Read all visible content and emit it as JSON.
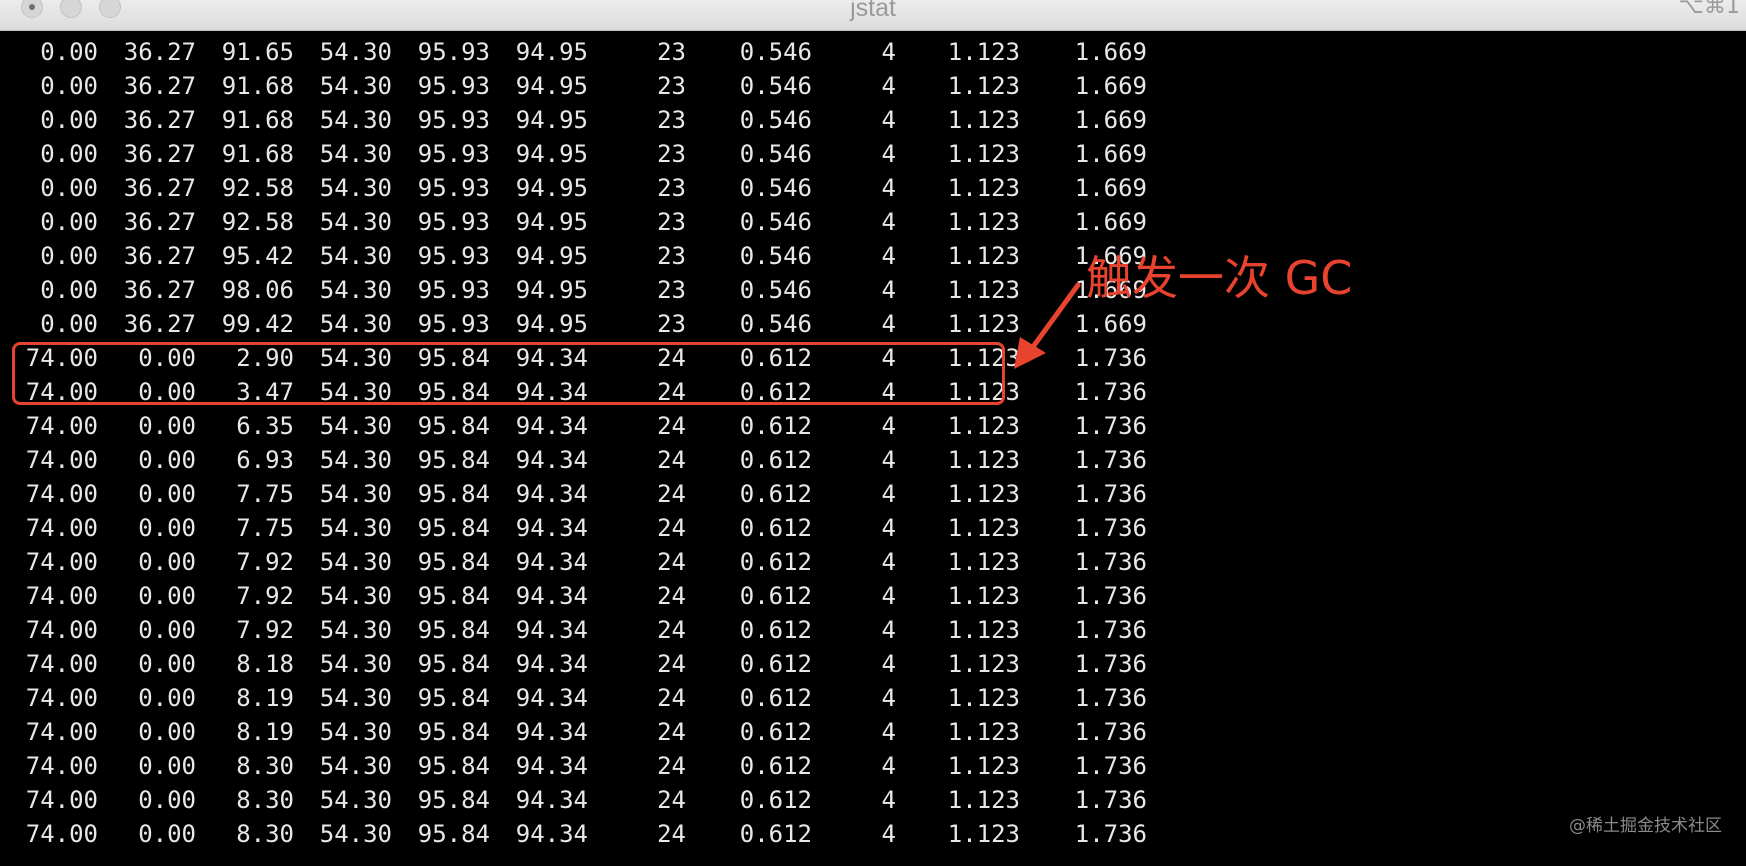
{
  "window": {
    "title": "jstat",
    "shortcut": "⌥⌘1"
  },
  "annotation": {
    "label": "触发一次 GC",
    "colors": {
      "accent": "#e8432f"
    }
  },
  "watermark": "@稀土掘金技术社区",
  "rows": [
    [
      "0.00",
      "36.27",
      "91.65",
      "54.30",
      "95.93",
      "94.95",
      "23",
      "0.546",
      "4",
      "1.123",
      "1.669"
    ],
    [
      "0.00",
      "36.27",
      "91.68",
      "54.30",
      "95.93",
      "94.95",
      "23",
      "0.546",
      "4",
      "1.123",
      "1.669"
    ],
    [
      "0.00",
      "36.27",
      "91.68",
      "54.30",
      "95.93",
      "94.95",
      "23",
      "0.546",
      "4",
      "1.123",
      "1.669"
    ],
    [
      "0.00",
      "36.27",
      "91.68",
      "54.30",
      "95.93",
      "94.95",
      "23",
      "0.546",
      "4",
      "1.123",
      "1.669"
    ],
    [
      "0.00",
      "36.27",
      "92.58",
      "54.30",
      "95.93",
      "94.95",
      "23",
      "0.546",
      "4",
      "1.123",
      "1.669"
    ],
    [
      "0.00",
      "36.27",
      "92.58",
      "54.30",
      "95.93",
      "94.95",
      "23",
      "0.546",
      "4",
      "1.123",
      "1.669"
    ],
    [
      "0.00",
      "36.27",
      "95.42",
      "54.30",
      "95.93",
      "94.95",
      "23",
      "0.546",
      "4",
      "1.123",
      "1.669"
    ],
    [
      "0.00",
      "36.27",
      "98.06",
      "54.30",
      "95.93",
      "94.95",
      "23",
      "0.546",
      "4",
      "1.123",
      "1.669"
    ],
    [
      "0.00",
      "36.27",
      "99.42",
      "54.30",
      "95.93",
      "94.95",
      "23",
      "0.546",
      "4",
      "1.123",
      "1.669"
    ],
    [
      "74.00",
      "0.00",
      "2.90",
      "54.30",
      "95.84",
      "94.34",
      "24",
      "0.612",
      "4",
      "1.123",
      "1.736"
    ],
    [
      "74.00",
      "0.00",
      "3.47",
      "54.30",
      "95.84",
      "94.34",
      "24",
      "0.612",
      "4",
      "1.123",
      "1.736"
    ],
    [
      "74.00",
      "0.00",
      "6.35",
      "54.30",
      "95.84",
      "94.34",
      "24",
      "0.612",
      "4",
      "1.123",
      "1.736"
    ],
    [
      "74.00",
      "0.00",
      "6.93",
      "54.30",
      "95.84",
      "94.34",
      "24",
      "0.612",
      "4",
      "1.123",
      "1.736"
    ],
    [
      "74.00",
      "0.00",
      "7.75",
      "54.30",
      "95.84",
      "94.34",
      "24",
      "0.612",
      "4",
      "1.123",
      "1.736"
    ],
    [
      "74.00",
      "0.00",
      "7.75",
      "54.30",
      "95.84",
      "94.34",
      "24",
      "0.612",
      "4",
      "1.123",
      "1.736"
    ],
    [
      "74.00",
      "0.00",
      "7.92",
      "54.30",
      "95.84",
      "94.34",
      "24",
      "0.612",
      "4",
      "1.123",
      "1.736"
    ],
    [
      "74.00",
      "0.00",
      "7.92",
      "54.30",
      "95.84",
      "94.34",
      "24",
      "0.612",
      "4",
      "1.123",
      "1.736"
    ],
    [
      "74.00",
      "0.00",
      "7.92",
      "54.30",
      "95.84",
      "94.34",
      "24",
      "0.612",
      "4",
      "1.123",
      "1.736"
    ],
    [
      "74.00",
      "0.00",
      "8.18",
      "54.30",
      "95.84",
      "94.34",
      "24",
      "0.612",
      "4",
      "1.123",
      "1.736"
    ],
    [
      "74.00",
      "0.00",
      "8.19",
      "54.30",
      "95.84",
      "94.34",
      "24",
      "0.612",
      "4",
      "1.123",
      "1.736"
    ],
    [
      "74.00",
      "0.00",
      "8.19",
      "54.30",
      "95.84",
      "94.34",
      "24",
      "0.612",
      "4",
      "1.123",
      "1.736"
    ],
    [
      "74.00",
      "0.00",
      "8.30",
      "54.30",
      "95.84",
      "94.34",
      "24",
      "0.612",
      "4",
      "1.123",
      "1.736"
    ],
    [
      "74.00",
      "0.00",
      "8.30",
      "54.30",
      "95.84",
      "94.34",
      "24",
      "0.612",
      "4",
      "1.123",
      "1.736"
    ],
    [
      "74.00",
      "0.00",
      "8.30",
      "54.30",
      "95.84",
      "94.34",
      "24",
      "0.612",
      "4",
      "1.123",
      "1.736"
    ]
  ]
}
